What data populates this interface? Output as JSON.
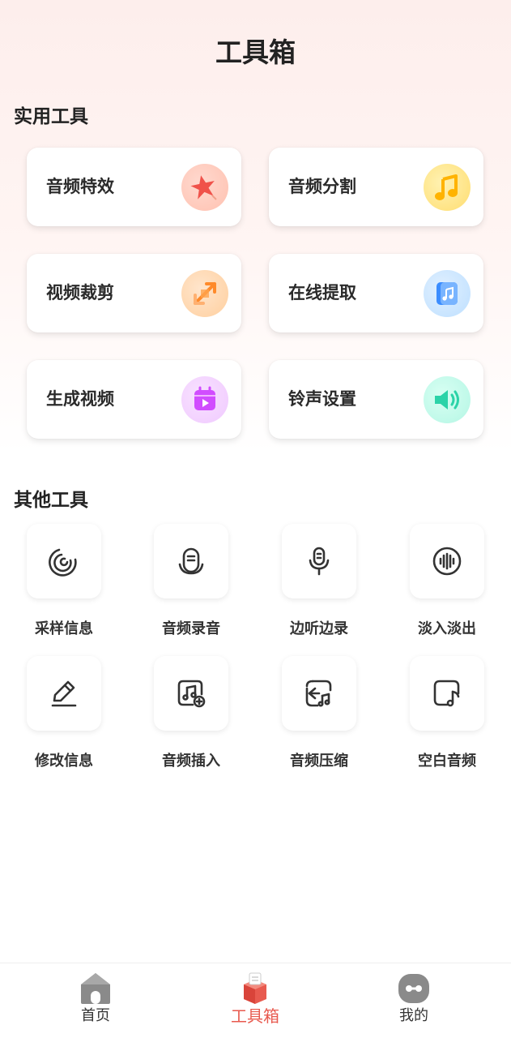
{
  "header": {
    "title": "工具箱"
  },
  "sections": {
    "practical": "实用工具",
    "other": "其他工具"
  },
  "practical_tools": [
    {
      "label": "音频特效",
      "icon": "star-effect-icon",
      "color": "#ff5a4a"
    },
    {
      "label": "音频分割",
      "icon": "music-note-icon",
      "color": "#ffb300"
    },
    {
      "label": "视频裁剪",
      "icon": "crop-arrows-icon",
      "color": "#ff8a2a"
    },
    {
      "label": "在线提取",
      "icon": "music-file-icon",
      "color": "#2f8cff"
    },
    {
      "label": "生成视频",
      "icon": "video-calendar-icon",
      "color": "#d14dff"
    },
    {
      "label": "铃声设置",
      "icon": "speaker-icon",
      "color": "#2bd3a8"
    }
  ],
  "other_tools": [
    {
      "label": "采样信息",
      "icon": "sampling-icon"
    },
    {
      "label": "音频录音",
      "icon": "microphone-capsule-icon"
    },
    {
      "label": "边听边录",
      "icon": "microphone-icon"
    },
    {
      "label": "淡入淡出",
      "icon": "waveform-icon"
    },
    {
      "label": "修改信息",
      "icon": "pencil-icon"
    },
    {
      "label": "音频插入",
      "icon": "music-add-icon"
    },
    {
      "label": "音频压缩",
      "icon": "music-compress-icon"
    },
    {
      "label": "空白音频",
      "icon": "blank-music-icon"
    }
  ],
  "bottom_nav": [
    {
      "label": "首页",
      "icon": "home-icon",
      "active": false
    },
    {
      "label": "工具箱",
      "icon": "toolbox-icon",
      "active": true
    },
    {
      "label": "我的",
      "icon": "profile-icon",
      "active": false
    }
  ],
  "colors": {
    "accent": "#e85a4f",
    "text": "#222222"
  }
}
